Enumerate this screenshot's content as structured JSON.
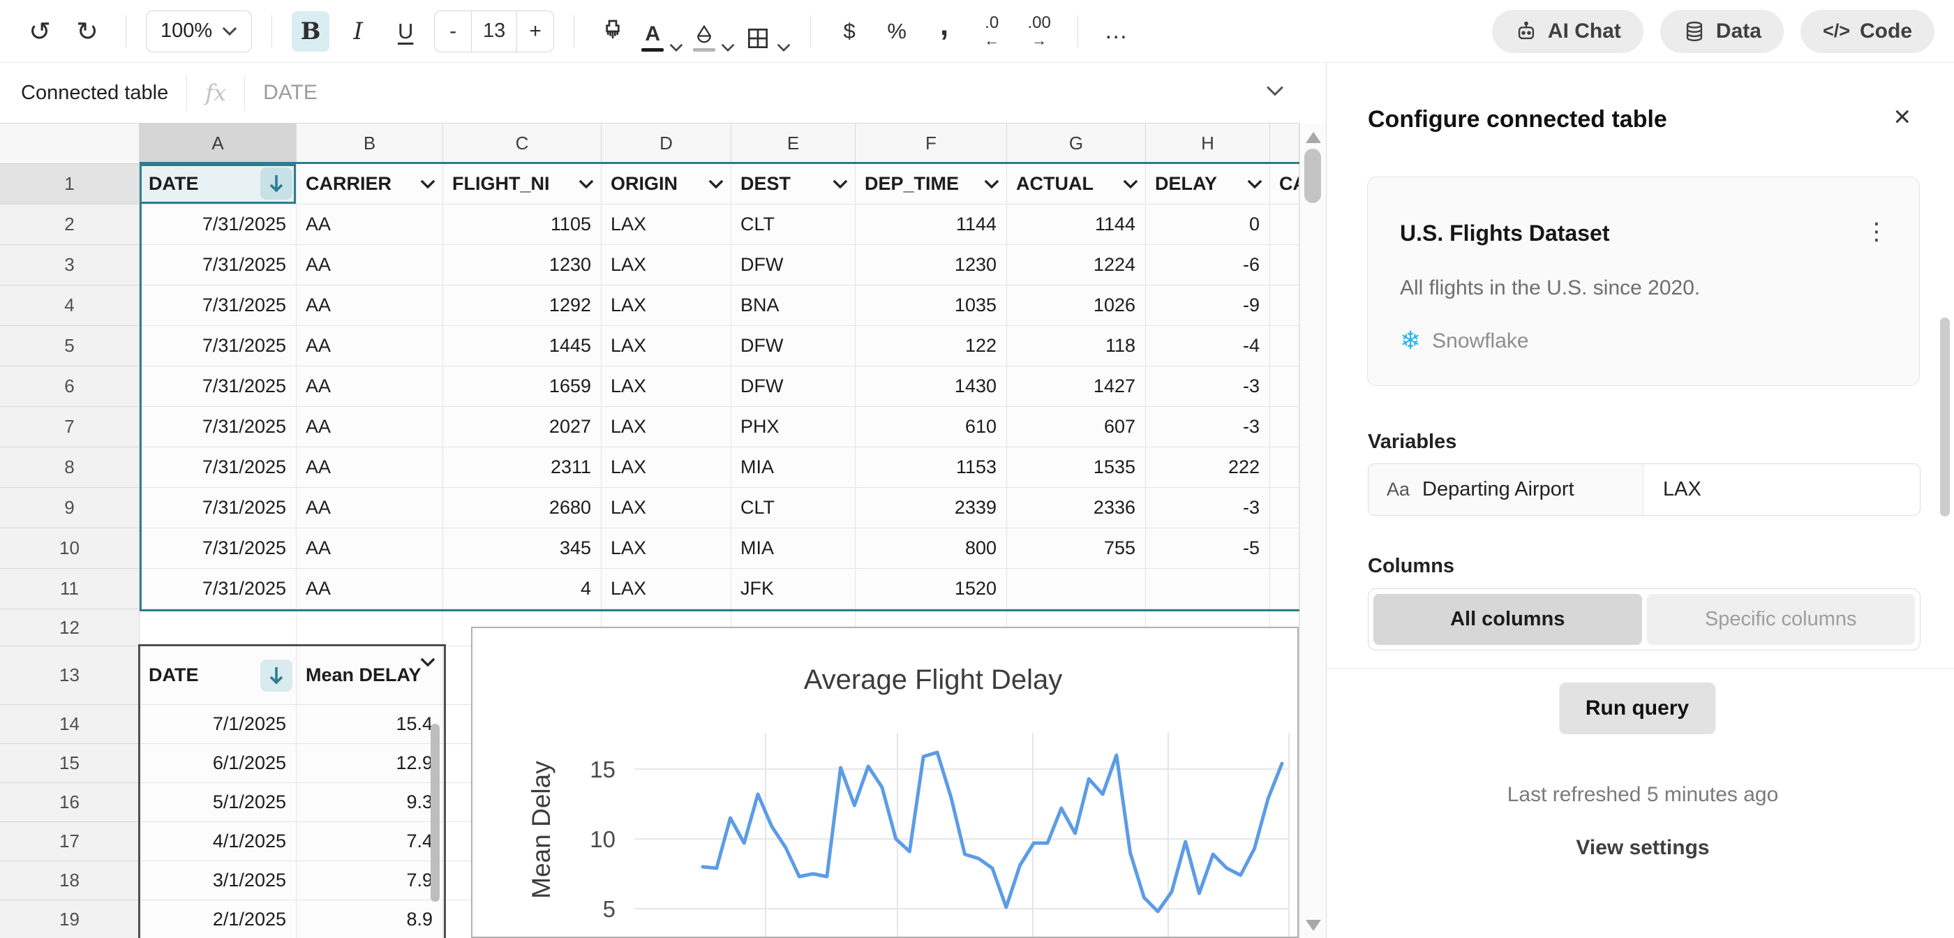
{
  "toolbar": {
    "undo_icon": "↺",
    "redo_icon": "↻",
    "zoom_value": "100%",
    "bold_label": "B",
    "italic_label": "I",
    "underline_label": "U",
    "font_size_minus": "-",
    "font_size_value": "13",
    "font_size_plus": "+",
    "text_color_label": "A",
    "currency_label": "$",
    "percent_label": "%",
    "comma_label": ",",
    "decrease_decimal_label": ".0",
    "decrease_decimal_arrow": "←",
    "increase_decimal_label": ".00",
    "increase_decimal_arrow": "→",
    "more_label": "…",
    "ai_chat_label": "AI Chat",
    "data_label": "Data",
    "code_label": "Code",
    "code_icon": "</>"
  },
  "formula_bar": {
    "left_label": "Connected table",
    "fx_label": "fx",
    "current_ref": "DATE"
  },
  "grid": {
    "column_letters": [
      "A",
      "B",
      "C",
      "D",
      "E",
      "F",
      "G",
      "H"
    ],
    "row_numbers": [
      1,
      2,
      3,
      4,
      5,
      6,
      7,
      8,
      9,
      10,
      11,
      12,
      13,
      14,
      15,
      16,
      17,
      18,
      19
    ],
    "selected_column": "A",
    "selected_row": 1
  },
  "table1": {
    "headers": [
      "DATE",
      "CARRIER",
      "FLIGHT_NI",
      "ORIGIN",
      "DEST",
      "DEP_TIME",
      "ACTUAL",
      "DELAY",
      "CA"
    ],
    "sorted_column": "DATE",
    "rows": [
      [
        "7/31/2025",
        "AA",
        "1105",
        "LAX",
        "CLT",
        "1144",
        "1144",
        "0",
        ""
      ],
      [
        "7/31/2025",
        "AA",
        "1230",
        "LAX",
        "DFW",
        "1230",
        "1224",
        "-6",
        ""
      ],
      [
        "7/31/2025",
        "AA",
        "1292",
        "LAX",
        "BNA",
        "1035",
        "1026",
        "-9",
        ""
      ],
      [
        "7/31/2025",
        "AA",
        "1445",
        "LAX",
        "DFW",
        "122",
        "118",
        "-4",
        ""
      ],
      [
        "7/31/2025",
        "AA",
        "1659",
        "LAX",
        "DFW",
        "1430",
        "1427",
        "-3",
        ""
      ],
      [
        "7/31/2025",
        "AA",
        "2027",
        "LAX",
        "PHX",
        "610",
        "607",
        "-3",
        ""
      ],
      [
        "7/31/2025",
        "AA",
        "2311",
        "LAX",
        "MIA",
        "1153",
        "1535",
        "222",
        ""
      ],
      [
        "7/31/2025",
        "AA",
        "2680",
        "LAX",
        "CLT",
        "2339",
        "2336",
        "-3",
        ""
      ],
      [
        "7/31/2025",
        "AA",
        "345",
        "LAX",
        "MIA",
        "800",
        "755",
        "-5",
        ""
      ],
      [
        "7/31/2025",
        "AA",
        "4",
        "LAX",
        "JFK",
        "1520",
        "",
        "",
        ""
      ]
    ]
  },
  "table2": {
    "headers": [
      "DATE",
      "Mean DELAY"
    ],
    "sorted_column": "DATE",
    "rows": [
      [
        "7/1/2025",
        "15.4"
      ],
      [
        "6/1/2025",
        "12.9"
      ],
      [
        "5/1/2025",
        "9.3"
      ],
      [
        "4/1/2025",
        "7.4"
      ],
      [
        "3/1/2025",
        "7.9"
      ],
      [
        "2/1/2025",
        "8.9"
      ]
    ]
  },
  "chart_data": {
    "type": "line",
    "title": "Average Flight Delay",
    "ylabel": "Mean Delay",
    "yticks": [
      5,
      10,
      15
    ],
    "ylim": [
      3.5,
      17.5
    ],
    "grid": true,
    "legend": "none",
    "line_color": "#5c9ce5",
    "values": [
      8.0,
      7.9,
      11.5,
      9.7,
      13.2,
      10.9,
      9.4,
      7.3,
      7.5,
      7.3,
      15.1,
      12.4,
      15.2,
      13.7,
      10.0,
      9.1,
      15.9,
      16.2,
      13.0,
      8.9,
      8.6,
      7.9,
      5.1,
      8.1,
      9.7,
      9.7,
      12.2,
      10.4,
      14.3,
      13.2,
      16.0,
      9.0,
      5.8,
      4.8,
      6.2,
      9.8,
      6.1,
      8.9,
      7.9,
      7.4,
      9.3,
      12.9,
      15.4
    ]
  },
  "panel": {
    "title": "Configure connected table",
    "close_icon": "×",
    "card": {
      "title": "U.S. Flights Dataset",
      "kebab_icon": "⋮",
      "description": "All flights in the U.S. since 2020.",
      "source_name": "Snowflake",
      "source_icon": "❄",
      "source_color": "#29b5e8"
    },
    "variables_label": "Variables",
    "variable": {
      "icon": "Aa",
      "name": "Departing Airport",
      "value": "LAX"
    },
    "columns_label": "Columns",
    "columns_all_label": "All columns",
    "columns_specific_label": "Specific columns",
    "columns_selected": "All columns",
    "run_query_label": "Run query",
    "last_refreshed": "Last refreshed 5 minutes ago",
    "view_settings_label": "View settings"
  },
  "colors": {
    "accent_teal": "#2e7d8f",
    "selected_fill": "#e8f2f4",
    "snowflake_blue": "#29b5e8",
    "chart_line": "#5c9ce5"
  }
}
